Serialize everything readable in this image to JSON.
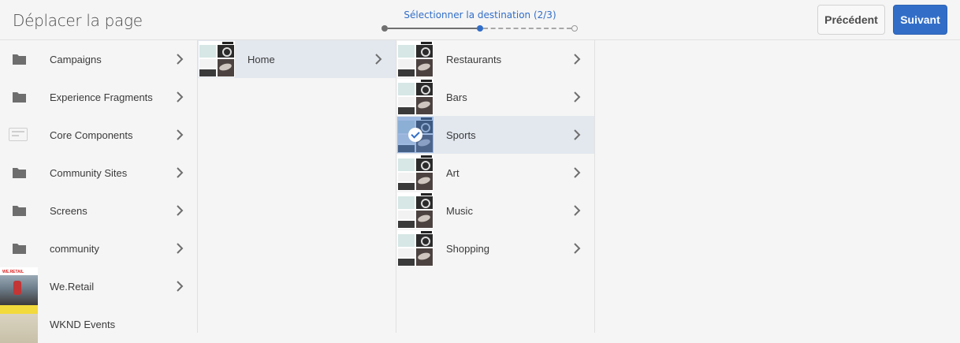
{
  "header": {
    "title": "Déplacer la page",
    "step_label": "Sélectionner la destination (2/3)",
    "prev_label": "Précédent",
    "next_label": "Suivant"
  },
  "colors": {
    "accent": "#326ec8",
    "selected_row": "#e3e8ef"
  },
  "column1": [
    {
      "label": "Campaigns",
      "icon": "folder-icon"
    },
    {
      "label": "Experience Fragments",
      "icon": "folder-icon"
    },
    {
      "label": "Core Components",
      "icon": "component-icon"
    },
    {
      "label": "Community Sites",
      "icon": "folder-icon"
    },
    {
      "label": "Screens",
      "icon": "folder-icon"
    },
    {
      "label": "community",
      "icon": "folder-icon"
    },
    {
      "label": "We.Retail",
      "icon": "page-thumbnail"
    },
    {
      "label": "WKND Events",
      "icon": "page-thumbnail"
    }
  ],
  "we_retail_logo": "WE.RETAIL",
  "column2": [
    {
      "label": "Home",
      "icon": "page-thumbnail"
    }
  ],
  "column3": [
    {
      "label": "Restaurants",
      "icon": "page-thumbnail"
    },
    {
      "label": "Bars",
      "icon": "page-thumbnail"
    },
    {
      "label": "Sports",
      "icon": "page-thumbnail",
      "selected": true
    },
    {
      "label": "Art",
      "icon": "page-thumbnail"
    },
    {
      "label": "Music",
      "icon": "page-thumbnail"
    },
    {
      "label": "Shopping",
      "icon": "page-thumbnail"
    }
  ]
}
